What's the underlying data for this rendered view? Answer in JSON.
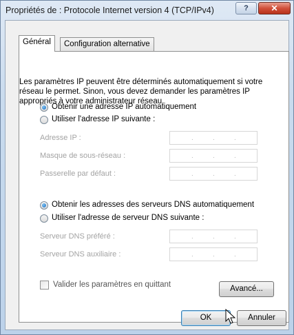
{
  "window": {
    "title": "Propriétés de : Protocole Internet version 4 (TCP/IPv4)",
    "help_label": "?",
    "close_label": "✕"
  },
  "tabs": [
    {
      "label": "Général",
      "active": true
    },
    {
      "label": "Configuration alternative",
      "active": false
    }
  ],
  "intro_text": "Les paramètres IP peuvent être déterminés automatiquement si votre réseau le permet. Sinon, vous devez demander les paramètres IP appropriés à votre administrateur réseau.",
  "ip_options": {
    "auto_label": "Obtenir une adresse IP automatiquement",
    "manual_label": "Utiliser l'adresse IP suivante :",
    "selected": "auto"
  },
  "ip_fields": [
    {
      "label": "Adresse IP :",
      "value": ""
    },
    {
      "label": "Masque de sous-réseau :",
      "value": ""
    },
    {
      "label": "Passerelle par défaut :",
      "value": ""
    }
  ],
  "dns_options": {
    "auto_label": "Obtenir les adresses des serveurs DNS automatiquement",
    "manual_label": "Utiliser l'adresse de serveur DNS suivante :",
    "selected": "auto"
  },
  "dns_fields": [
    {
      "label": "Serveur DNS préféré :",
      "value": ""
    },
    {
      "label": "Serveur DNS auxiliaire :",
      "value": ""
    }
  ],
  "validate_checkbox": {
    "label": "Valider les paramètres en quittant",
    "checked": false
  },
  "buttons": {
    "advanced": "Avancé...",
    "ok": "OK",
    "cancel": "Annuler"
  },
  "ip_separator": "."
}
